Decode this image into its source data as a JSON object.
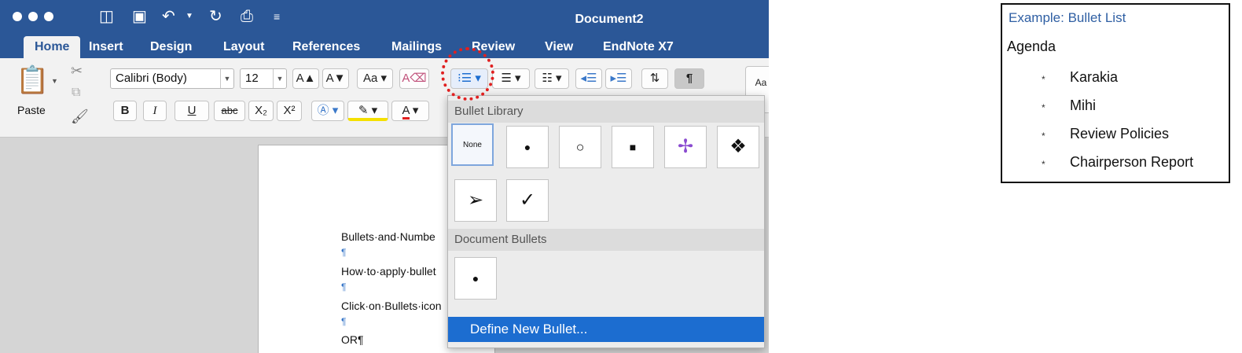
{
  "window": {
    "title": "Document2",
    "quick_access": [
      "sidebar-icon",
      "save-icon",
      "undo-icon",
      "redo-icon",
      "print-icon",
      "customize-icon"
    ],
    "tabs": [
      "Home",
      "Insert",
      "Design",
      "Layout",
      "References",
      "Mailings",
      "Review",
      "View",
      "EndNote X7"
    ],
    "active_tab": "Home",
    "accent_color": "#2b5797"
  },
  "ribbon": {
    "paste_label": "Paste",
    "font_name": "Calibri (Body)",
    "font_size": "12",
    "grow_font": "A▲",
    "shrink_font": "A▼",
    "bold": "B",
    "italic": "I",
    "underline": "U",
    "strikethrough": "abc",
    "subscript": "X₂",
    "superscript": "X²",
    "style_preview": "Aa"
  },
  "document": {
    "lines": [
      "Bullets·and·Numbe",
      "¶",
      "How·to·apply·bullet",
      "¶",
      "Click·on·Bullets·icon",
      "¶",
      "OR¶"
    ]
  },
  "bullet_menu": {
    "library_header": "Bullet Library",
    "library": [
      "None",
      "●",
      "○",
      "■",
      "✢",
      "❖",
      "➢",
      "✓"
    ],
    "document_header": "Document Bullets",
    "document_bullets": [
      "●"
    ],
    "define_label": "Define New Bullet...",
    "highlight_color": "#1c6dd0"
  },
  "example": {
    "title": "Example:  Bullet List",
    "heading": "Agenda",
    "bullet": "*",
    "items": [
      "Karakia",
      "Mihi",
      "Review Policies",
      "Chairperson Report"
    ]
  }
}
